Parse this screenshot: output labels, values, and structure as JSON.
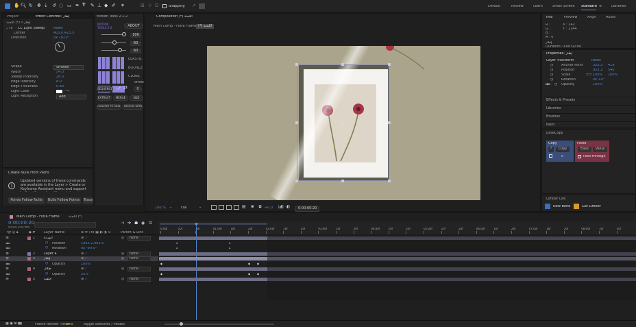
{
  "toolbar": {
    "snapping": "Snapping",
    "workspaces": [
      "Default",
      "Review",
      "Learn",
      "Small Screen",
      "Standard",
      "Libraries"
    ],
    "active_workspace": "Standard"
  },
  "project_panel": {
    "tab1": "Project",
    "tab2": "Effect Controls: إطار",
    "subtitle": "إطار • (*) اللجنة"
  },
  "effect_controls": {
    "effect_name": "CC Light Sweep",
    "reset": "Reset",
    "center_label": "Center",
    "center_value": "403.0,423.5",
    "direction_label": "Direction",
    "direction_value": "0x -30.0°",
    "rows": [
      {
        "label": "Shape",
        "value": "Smooth"
      },
      {
        "label": "Width",
        "value": "54.0"
      },
      {
        "label": "Sweep Intensity",
        "value": "28.0"
      },
      {
        "label": "Edge Intensity",
        "value": "8.0"
      },
      {
        "label": "Edge Thickness",
        "value": "0.80"
      },
      {
        "label": "Light Color",
        "value": ""
      },
      {
        "label": "Light Reception",
        "value": "Add"
      }
    ]
  },
  "nulls": {
    "title": "Create Nulls From Paths",
    "message": "Updated versions of these commands are available in the Layer > Create or Keyframe Assistant menu and support both paths and position points.",
    "buttons": [
      "Points Follow Nulls",
      "Nulls Follow Points",
      "Trace"
    ]
  },
  "motion_tools": {
    "title": "Motion Tools 2.1.2",
    "logo": "MOTION TOOLS 2.0",
    "about": "ABOUT",
    "sliders": [
      "100",
      "60",
      "60"
    ],
    "buttons": [
      "ELASTIC",
      "BOUNCE",
      "CLONE",
      "offset"
    ],
    "row1": [
      "SEQUENCE",
      "0"
    ],
    "row2": [
      "EXTRACT",
      "MERGE",
      "ADD"
    ],
    "row3": [
      "CONVERT TO SHAPE",
      "REMOVE ARTB"
    ]
  },
  "composition": {
    "tab": "Composition (*) اللجنة",
    "breadcrumb1": "Main Comp - Flora Frame",
    "breadcrumb2": "(*) اللجنة",
    "zoom": "100 %",
    "quality": "Full",
    "offset": "+0.0",
    "timecode": "0:00:00:20"
  },
  "info_panel": {
    "tabs": [
      "Info",
      "Preview",
      "Align",
      "Audio"
    ],
    "r": "R :",
    "g": "G :",
    "b": "B :",
    "a": "A : 0",
    "x": "X : 242",
    "y": "Y : 1144",
    "layer_name": "إطار",
    "duration": "Duration: 0:00:02:00"
  },
  "properties": {
    "title": "Properties: إطار",
    "section": "Layer Transform",
    "reset": "Reset",
    "rows": [
      {
        "label": "Anchor Point",
        "v1": "323.3",
        "v2": "418"
      },
      {
        "label": "Position",
        "v1": "953.3",
        "v2": "540"
      },
      {
        "label": "Scale",
        "v1": "100%",
        "v2": "100%"
      },
      {
        "label": "Rotation",
        "v1": "0x +0°",
        "v2": ""
      },
      {
        "label": "Opacity",
        "v1": "100%",
        "v2": ""
      }
    ],
    "sections": [
      "Effects & Presets",
      "Libraries",
      "Brushes",
      "Paint"
    ]
  },
  "ease_copy": {
    "title": "EaseCopy",
    "copy_head": "Copy",
    "paste_head": "Paste",
    "copy_btn": "Copy",
    "ease_btn": "Ease",
    "value_btn": "Value",
    "index": "0",
    "pass": "Pass-through",
    "qmark": "?"
  },
  "limber": {
    "title": "Limber Lite",
    "new_bone": "New Bone",
    "get_limber": "Get Limber"
  },
  "timeline": {
    "tab": "Main Comp - Flora Frame",
    "tab2": "اللجنة (*)",
    "timecode": "0:00:00:20",
    "fps": "00020 (25.00 fps)",
    "search_placeholder": "Q▾",
    "col_layer": "Layer Name",
    "col_parent": "Parent & Link",
    "layers": [
      {
        "num": "1",
        "name": "الوردة",
        "parent": "None",
        "kind": "layer"
      },
      {
        "num": "",
        "name": "Position",
        "val": "1453.2,463.5",
        "kind": "prop"
      },
      {
        "num": "",
        "name": "Rotation",
        "val": "0x -90.0°",
        "kind": "prop"
      },
      {
        "num": "2",
        "name": "Layer 4",
        "parent": "None",
        "kind": "layer"
      },
      {
        "num": "3",
        "name": "إطار",
        "parent": "None",
        "kind": "layer"
      },
      {
        "num": "",
        "name": "Opacity",
        "val": "100%",
        "kind": "prop"
      },
      {
        "num": "4",
        "name": "ظلال",
        "parent": "None",
        "kind": "layer"
      },
      {
        "num": "",
        "name": "Opacity",
        "val": "25%",
        "kind": "prop"
      },
      {
        "num": "5",
        "name": "خلفية",
        "parent": "None",
        "kind": "layer"
      }
    ],
    "ruler": [
      "0:00f",
      "10f",
      "20f",
      "01:00f",
      "10f",
      "20f",
      "02:00f",
      "10f",
      "20f",
      "03:00f",
      "10f",
      "20f",
      "04:00f",
      "10f",
      "20f",
      "05:00f",
      "10f",
      "20f",
      "06:00f",
      "10f",
      "20f",
      "07:00f",
      "10f",
      "20f",
      "08:00f",
      "10f",
      "20f"
    ],
    "status_render": "Frame Render Time:",
    "render_ms": "3ms",
    "toggle": "Toggle Switches / Modes"
  }
}
